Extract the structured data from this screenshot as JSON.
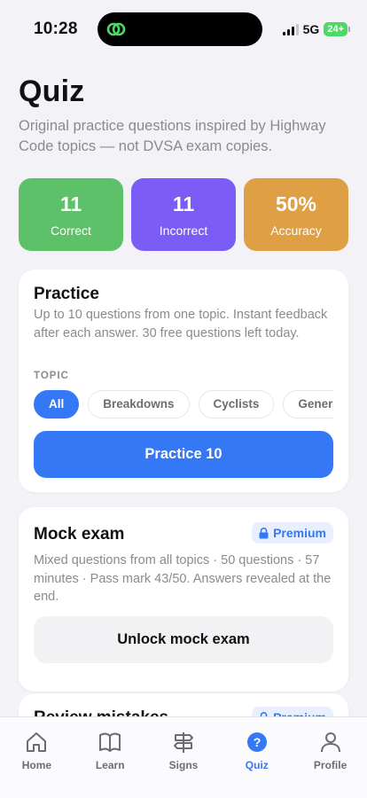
{
  "status_bar": {
    "time": "10:28",
    "network": "5G",
    "battery": "24+"
  },
  "header": {
    "title": "Quiz",
    "subtitle": "Original practice questions inspired by Highway Code topics — not DVSA exam copies."
  },
  "stats": [
    {
      "value": "11",
      "label": "Correct",
      "color": "#5cc168"
    },
    {
      "value": "11",
      "label": "Incorrect",
      "color": "#7b5cf6"
    },
    {
      "value": "50%",
      "label": "Accuracy",
      "color": "#df9f44"
    }
  ],
  "practice": {
    "title": "Practice",
    "description": "Up to 10 questions from one topic. Instant feedback after each answer. 30 free questions left today.",
    "topic_label": "TOPIC",
    "topics": [
      "All",
      "Breakdowns",
      "Cyclists",
      "General"
    ],
    "selected_topic": "All",
    "button_label": "Practice 10"
  },
  "mock_exam": {
    "title": "Mock exam",
    "badge": "Premium",
    "description": "Mixed questions from all topics · 50 questions · 57 minutes · Pass mark 43/50. Answers revealed at the end.",
    "button_label": "Unlock mock exam"
  },
  "review": {
    "title": "Review mistakes",
    "badge": "Premium"
  },
  "tabs": [
    {
      "label": "Home",
      "icon": "home-icon"
    },
    {
      "label": "Learn",
      "icon": "book-icon"
    },
    {
      "label": "Signs",
      "icon": "signpost-icon"
    },
    {
      "label": "Quiz",
      "icon": "question-icon",
      "active": true
    },
    {
      "label": "Profile",
      "icon": "person-icon"
    }
  ],
  "colors": {
    "accent": "#3478f6",
    "background": "#f2f2f7"
  }
}
